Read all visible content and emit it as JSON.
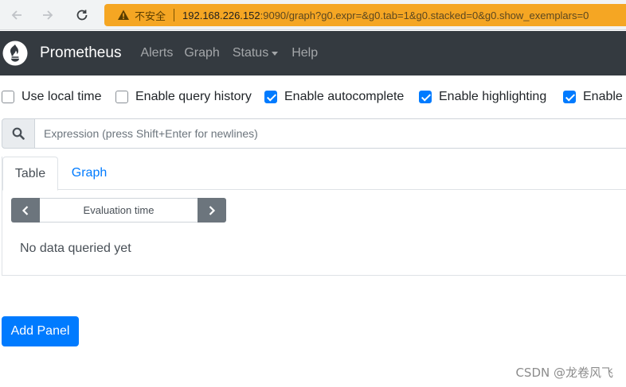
{
  "browser": {
    "back_icon": "arrow-left-icon",
    "forward_icon": "arrow-right-icon",
    "reload_icon": "reload-icon",
    "security_label": "不安全",
    "url_host": "192.168.226.152",
    "url_rest": ":9090/graph?g0.expr=&g0.tab=1&g0.stacked=0&g0.show_exemplars=0"
  },
  "navbar": {
    "brand": "Prometheus",
    "links": {
      "alerts": "Alerts",
      "graph": "Graph",
      "status": "Status",
      "help": "Help"
    }
  },
  "options": [
    {
      "label": "Use local time",
      "checked": false
    },
    {
      "label": "Enable query history",
      "checked": false
    },
    {
      "label": "Enable autocomplete",
      "checked": true
    },
    {
      "label": "Enable highlighting",
      "checked": true
    },
    {
      "label": "Enable linter",
      "checked": true
    }
  ],
  "expression": {
    "placeholder": "Expression (press Shift+Enter for newlines)",
    "value": ""
  },
  "panel": {
    "tabs": {
      "table": "Table",
      "graph": "Graph"
    },
    "active_tab": "Table",
    "eval_time_placeholder": "Evaluation time",
    "no_data": "No data queried yet"
  },
  "add_panel_label": "Add Panel",
  "watermark": "CSDN @龙卷风飞",
  "colors": {
    "navbar_bg": "#343a40",
    "primary": "#007bff",
    "secondary": "#6c757d",
    "address_warning_bg": "#f5a623"
  }
}
